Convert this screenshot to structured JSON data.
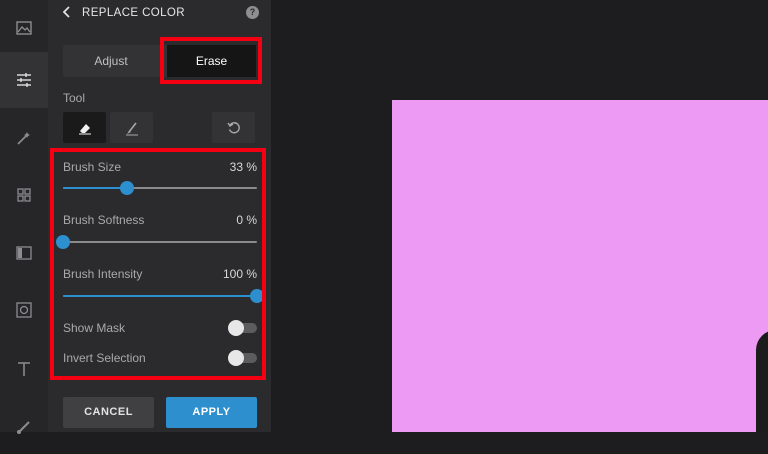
{
  "panel": {
    "title": "REPLACE COLOR",
    "help_glyph": "?",
    "tabs": [
      {
        "label": "Adjust",
        "selected": false
      },
      {
        "label": "Erase",
        "selected": true
      }
    ],
    "tool_label": "Tool",
    "tools": [
      "eraser-icon",
      "brush-icon",
      "reset-icon"
    ],
    "sliders": [
      {
        "label": "Brush Size",
        "display": "33 %",
        "value": 33
      },
      {
        "label": "Brush Softness",
        "display": "0 %",
        "value": 0
      },
      {
        "label": "Brush Intensity",
        "display": "100 %",
        "value": 100
      }
    ],
    "toggles": [
      {
        "label": "Show Mask",
        "on": false
      },
      {
        "label": "Invert Selection",
        "on": false
      }
    ],
    "cancel_label": "CANCEL",
    "apply_label": "APPLY"
  },
  "rail_icons": [
    "image-icon",
    "adjust-sliders-icon",
    "magic-wand-icon",
    "grid-icon",
    "film-icon",
    "frame-icon",
    "text-icon",
    "brush-icon"
  ],
  "colors": {
    "accent": "#2d8fce",
    "highlight": "#f40012",
    "photo_fill": "#ec9af4"
  }
}
